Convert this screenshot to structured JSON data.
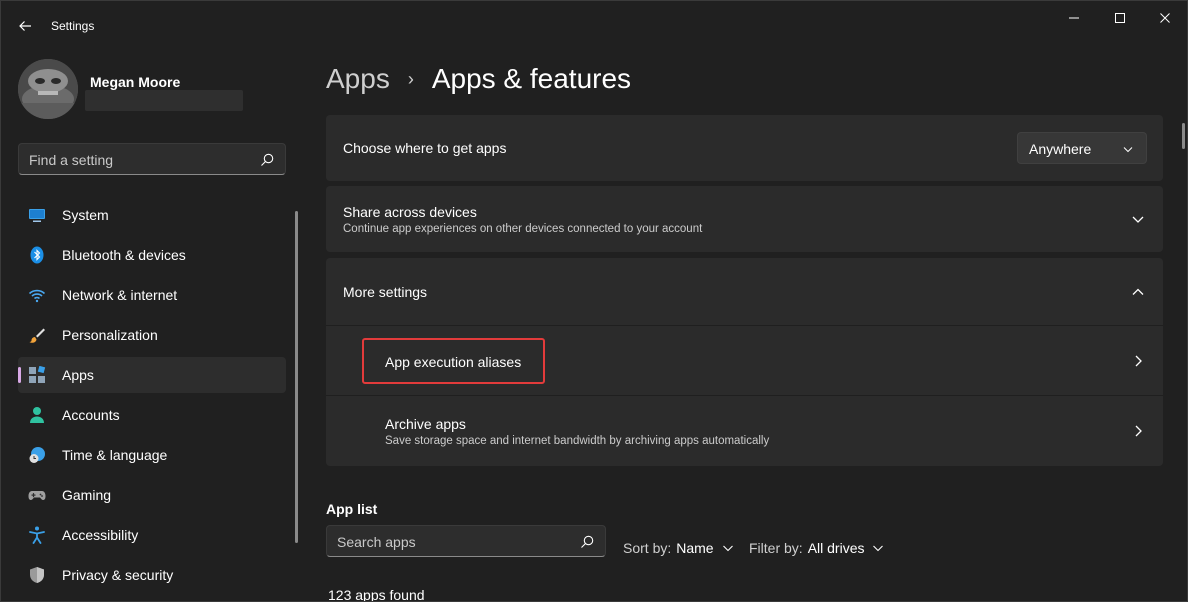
{
  "window": {
    "title": "Settings"
  },
  "profile": {
    "name": "Megan Moore"
  },
  "sidebar": {
    "search_placeholder": "Find a setting",
    "items": [
      {
        "label": "System",
        "icon": "system-icon"
      },
      {
        "label": "Bluetooth & devices",
        "icon": "bluetooth-icon"
      },
      {
        "label": "Network & internet",
        "icon": "wifi-icon"
      },
      {
        "label": "Personalization",
        "icon": "brush-icon"
      },
      {
        "label": "Apps",
        "icon": "apps-icon",
        "active": true
      },
      {
        "label": "Accounts",
        "icon": "accounts-icon"
      },
      {
        "label": "Time & language",
        "icon": "clock-globe-icon"
      },
      {
        "label": "Gaming",
        "icon": "gamepad-icon"
      },
      {
        "label": "Accessibility",
        "icon": "accessibility-icon"
      },
      {
        "label": "Privacy & security",
        "icon": "shield-icon"
      }
    ]
  },
  "breadcrumb": {
    "parent": "Apps",
    "separator": "›",
    "current": "Apps & features"
  },
  "cards": {
    "where_apps": {
      "title": "Choose where to get apps",
      "dropdown_value": "Anywhere"
    },
    "share": {
      "title": "Share across devices",
      "description": "Continue app experiences on other devices connected to your account"
    },
    "more": {
      "title": "More settings",
      "aliases_title": "App execution aliases",
      "archive_title": "Archive apps",
      "archive_description": "Save storage space and internet bandwidth by archiving apps automatically"
    }
  },
  "app_list": {
    "title": "App list",
    "search_placeholder": "Search apps",
    "sort_label": "Sort by:",
    "sort_value": "Name",
    "filter_label": "Filter by:",
    "filter_value": "All drives",
    "count_text": "123 apps found"
  },
  "colors": {
    "background": "#202020",
    "card": "#2b2b2b",
    "accent_indicator": "#d8a9e6",
    "highlight_border": "#e23b3b"
  }
}
